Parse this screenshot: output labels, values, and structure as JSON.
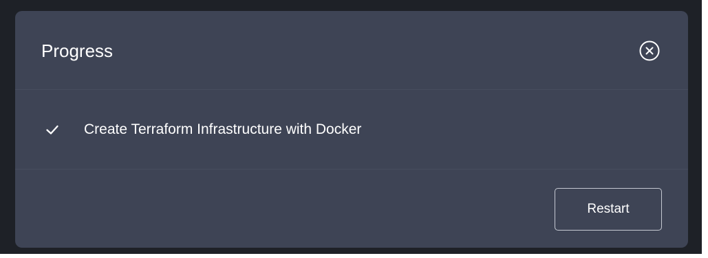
{
  "colors": {
    "backdrop": "#1e2127",
    "modal_background": "#3e4455",
    "divider": "#474d5e",
    "text": "#ffffff",
    "button_border": "#c6cad3"
  },
  "modal": {
    "title": "Progress",
    "close_icon": "close-circle-icon",
    "steps": [
      {
        "status_icon": "checkmark-icon",
        "label": "Create Terraform Infrastructure with Docker"
      }
    ],
    "footer": {
      "restart_label": "Restart"
    }
  }
}
